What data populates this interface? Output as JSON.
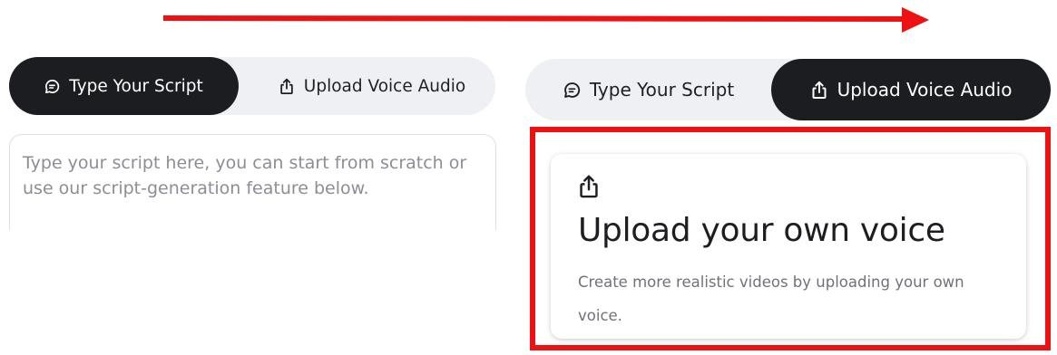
{
  "colors": {
    "annotation_red": "#ee1111",
    "active_tab_bg": "#1c1d21",
    "segment_bg": "#eef0f4",
    "placeholder_text": "#8b8e94"
  },
  "before_state": {
    "tabs": [
      {
        "label": "Type Your Script",
        "icon": "chat-bubble-icon",
        "active": true
      },
      {
        "label": "Upload Voice Audio",
        "icon": "share-upload-icon",
        "active": false
      }
    ],
    "script_input": {
      "placeholder": "Type your script here, you can start from scratch or use our script-generation feature below.",
      "value": ""
    }
  },
  "after_state": {
    "tabs": [
      {
        "label": "Type Your Script",
        "icon": "chat-bubble-icon",
        "active": false
      },
      {
        "label": "Upload Voice Audio",
        "icon": "share-upload-icon",
        "active": true
      }
    ],
    "upload_card": {
      "icon": "share-upload-icon",
      "title": "Upload your own voice",
      "description": "Create more realistic videos by uploading your own voice."
    }
  }
}
